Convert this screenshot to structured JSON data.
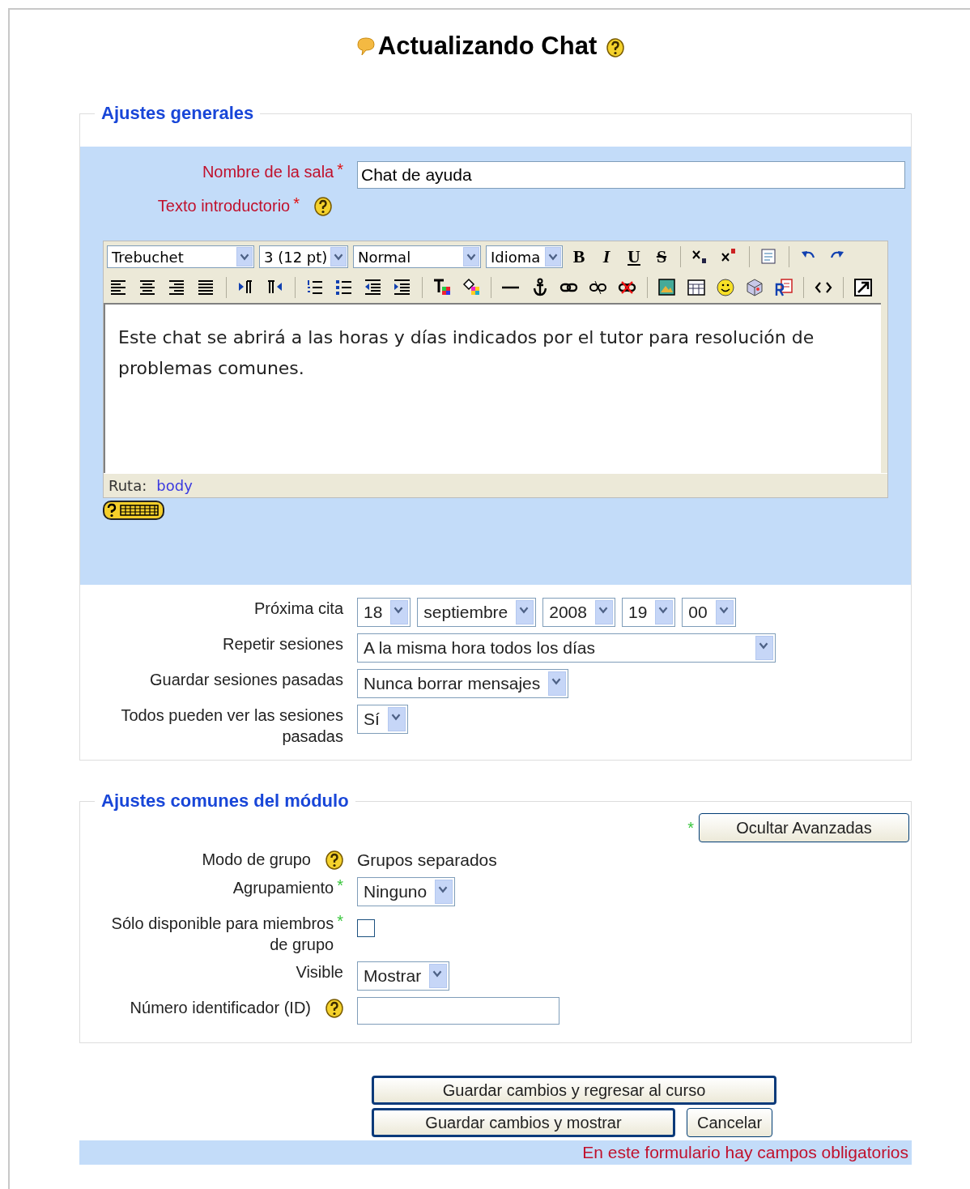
{
  "page_title": "Actualizando Chat",
  "general": {
    "legend": "Ajustes generales",
    "room_name": {
      "label": "Nombre de la sala",
      "required_mark": "*",
      "value": "Chat de ayuda"
    },
    "intro": {
      "label": "Texto introductorio",
      "required_mark": "*",
      "help": true
    },
    "editor": {
      "selects": [
        "Trebuchet",
        "3 (12 pt)",
        "Normal",
        "Idioma"
      ],
      "format_buttons": [
        "B",
        "I",
        "U",
        "S"
      ],
      "content": "Este chat se abrirá a las horas y días indicados por el tutor para resolución de problemas comunes.",
      "path_label": "Ruta:",
      "path_link": "body"
    },
    "rows": [
      {
        "kind": "selects",
        "label": "Próxima cita",
        "options": [
          "18",
          "septiembre",
          "2008",
          "19",
          "00"
        ]
      },
      {
        "kind": "select",
        "label": "Repetir sesiones",
        "value": "A la misma hora todos los días"
      },
      {
        "kind": "select",
        "label": "Guardar sesiones pasadas",
        "value": "Nunca borrar mensajes"
      },
      {
        "kind": "select",
        "label": "Todos pueden ver las sesiones pasadas",
        "value": "Sí"
      }
    ]
  },
  "module": {
    "legend": "Ajustes comunes del módulo",
    "advanced_mark": "*",
    "toggle_button": "Ocultar Avanzadas",
    "rows": [
      {
        "kind": "static",
        "label": "Modo de grupo",
        "help": true,
        "value": "Grupos separados"
      },
      {
        "kind": "select",
        "label": "Agrupamiento",
        "advanced_mark": "*",
        "value": "Ninguno"
      },
      {
        "kind": "checkbox",
        "label": "Sólo disponible para miembros de grupo",
        "advanced_mark": "*",
        "checked": false
      },
      {
        "kind": "select",
        "label": "Visible",
        "value": "Mostrar"
      },
      {
        "kind": "input",
        "label": "Número identificador (ID)",
        "help": true
      }
    ]
  },
  "buttons": [
    {
      "label": "Guardar cambios y regresar al curso",
      "default": true
    },
    {
      "label": "Guardar cambios y mostrar",
      "default": true
    },
    {
      "label": "Cancelar",
      "default": false
    }
  ],
  "required_note": "En este formulario hay campos obligatorios"
}
